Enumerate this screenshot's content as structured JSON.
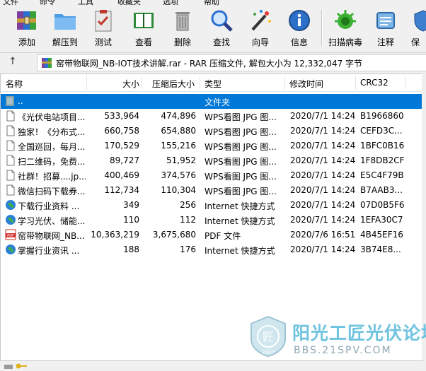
{
  "menu": [
    "文件",
    "命令",
    "工具",
    "收藏夹",
    "选项",
    "帮助"
  ],
  "toolbar": [
    {
      "label": "添加",
      "icon": "add-archive-icon"
    },
    {
      "label": "解压到",
      "icon": "extract-folder-icon"
    },
    {
      "label": "测试",
      "icon": "test-clipboard-icon"
    },
    {
      "label": "查看",
      "icon": "view-book-icon"
    },
    {
      "label": "删除",
      "icon": "delete-trash-icon"
    },
    {
      "label": "查找",
      "icon": "find-magnifier-icon"
    },
    {
      "label": "向导",
      "icon": "wizard-wand-icon"
    },
    {
      "label": "信息",
      "icon": "info-icon"
    },
    {
      "label": "扫描病毒",
      "icon": "virus-scan-icon"
    },
    {
      "label": "注释",
      "icon": "comment-icon"
    },
    {
      "label": "保",
      "icon": "protect-shield-icon"
    }
  ],
  "address": {
    "up_glyph": "↑",
    "path": "窑带物联网_NB-IOT技术讲解.rar - RAR 压缩文件, 解包大小为 12,332,047 字节"
  },
  "columns": {
    "name": "名称",
    "size": "大小",
    "packed": "压缩后大小",
    "type": "类型",
    "modified": "修改时间",
    "crc": "CRC32"
  },
  "rows": [
    {
      "name": "..",
      "size": "",
      "packed": "",
      "type": "文件夹",
      "modified": "",
      "crc": "",
      "icon": "folder-up-icon",
      "selected": true
    },
    {
      "name": "《光伏电站项目...",
      "size": "533,964",
      "packed": "474,896",
      "type": "WPS看图 JPG 图...",
      "modified": "2020/7/1 14:24",
      "crc": "B1966860",
      "icon": "jpg-file-icon"
    },
    {
      "name": "独家！《分布式...",
      "size": "660,758",
      "packed": "654,880",
      "type": "WPS看图 JPG 图...",
      "modified": "2020/7/1 14:24",
      "crc": "CEFD3C...",
      "icon": "jpg-file-icon"
    },
    {
      "name": "全国巡回，每月...",
      "size": "170,529",
      "packed": "155,216",
      "type": "WPS看图 JPG 图...",
      "modified": "2020/7/1 14:24",
      "crc": "1BFC0B16",
      "icon": "jpg-file-icon"
    },
    {
      "name": "扫二维码，免费...",
      "size": "89,727",
      "packed": "51,952",
      "type": "WPS看图 JPG 图...",
      "modified": "2020/7/1 14:24",
      "crc": "1F8DB2CF",
      "icon": "jpg-file-icon"
    },
    {
      "name": "社群！招募....jp...",
      "size": "400,469",
      "packed": "374,576",
      "type": "WPS看图 JPG 图...",
      "modified": "2020/7/1 14:24",
      "crc": "E5C4F79B",
      "icon": "jpg-file-icon"
    },
    {
      "name": "微信扫码下载券...",
      "size": "112,734",
      "packed": "110,304",
      "type": "WPS看图 JPG 图...",
      "modified": "2020/7/1 14:24",
      "crc": "B7AAB3...",
      "icon": "jpg-file-icon"
    },
    {
      "name": "下载行业资料 ...",
      "size": "349",
      "packed": "256",
      "type": "Internet 快捷方式",
      "modified": "2020/7/1 14:24",
      "crc": "07D0B5F6",
      "icon": "globe-icon"
    },
    {
      "name": "学习光伏、储能...",
      "size": "110",
      "packed": "112",
      "type": "Internet 快捷方式",
      "modified": "2020/7/1 14:24",
      "crc": "1EFA30C7",
      "icon": "globe-icon"
    },
    {
      "name": "窑带物联网_NB...",
      "size": "10,363,219",
      "packed": "3,675,680",
      "type": "PDF 文件",
      "modified": "2020/7/6 16:51",
      "crc": "4B45EF16",
      "icon": "pdf-file-icon"
    },
    {
      "name": "掌握行业资讯 ...",
      "size": "188",
      "packed": "176",
      "type": "Internet 快捷方式",
      "modified": "2020/7/1 14:24",
      "crc": "3B74E8...",
      "icon": "globe-icon"
    }
  ],
  "watermark": {
    "title": "阳光工匠光伏论坛",
    "url": "BBS.21SPV.COM",
    "year": "2007",
    "seal_char": "匠"
  },
  "colors": {
    "selection": "#0078d7",
    "virus_green": "#3cb034",
    "watermark": "#6fc3df"
  }
}
